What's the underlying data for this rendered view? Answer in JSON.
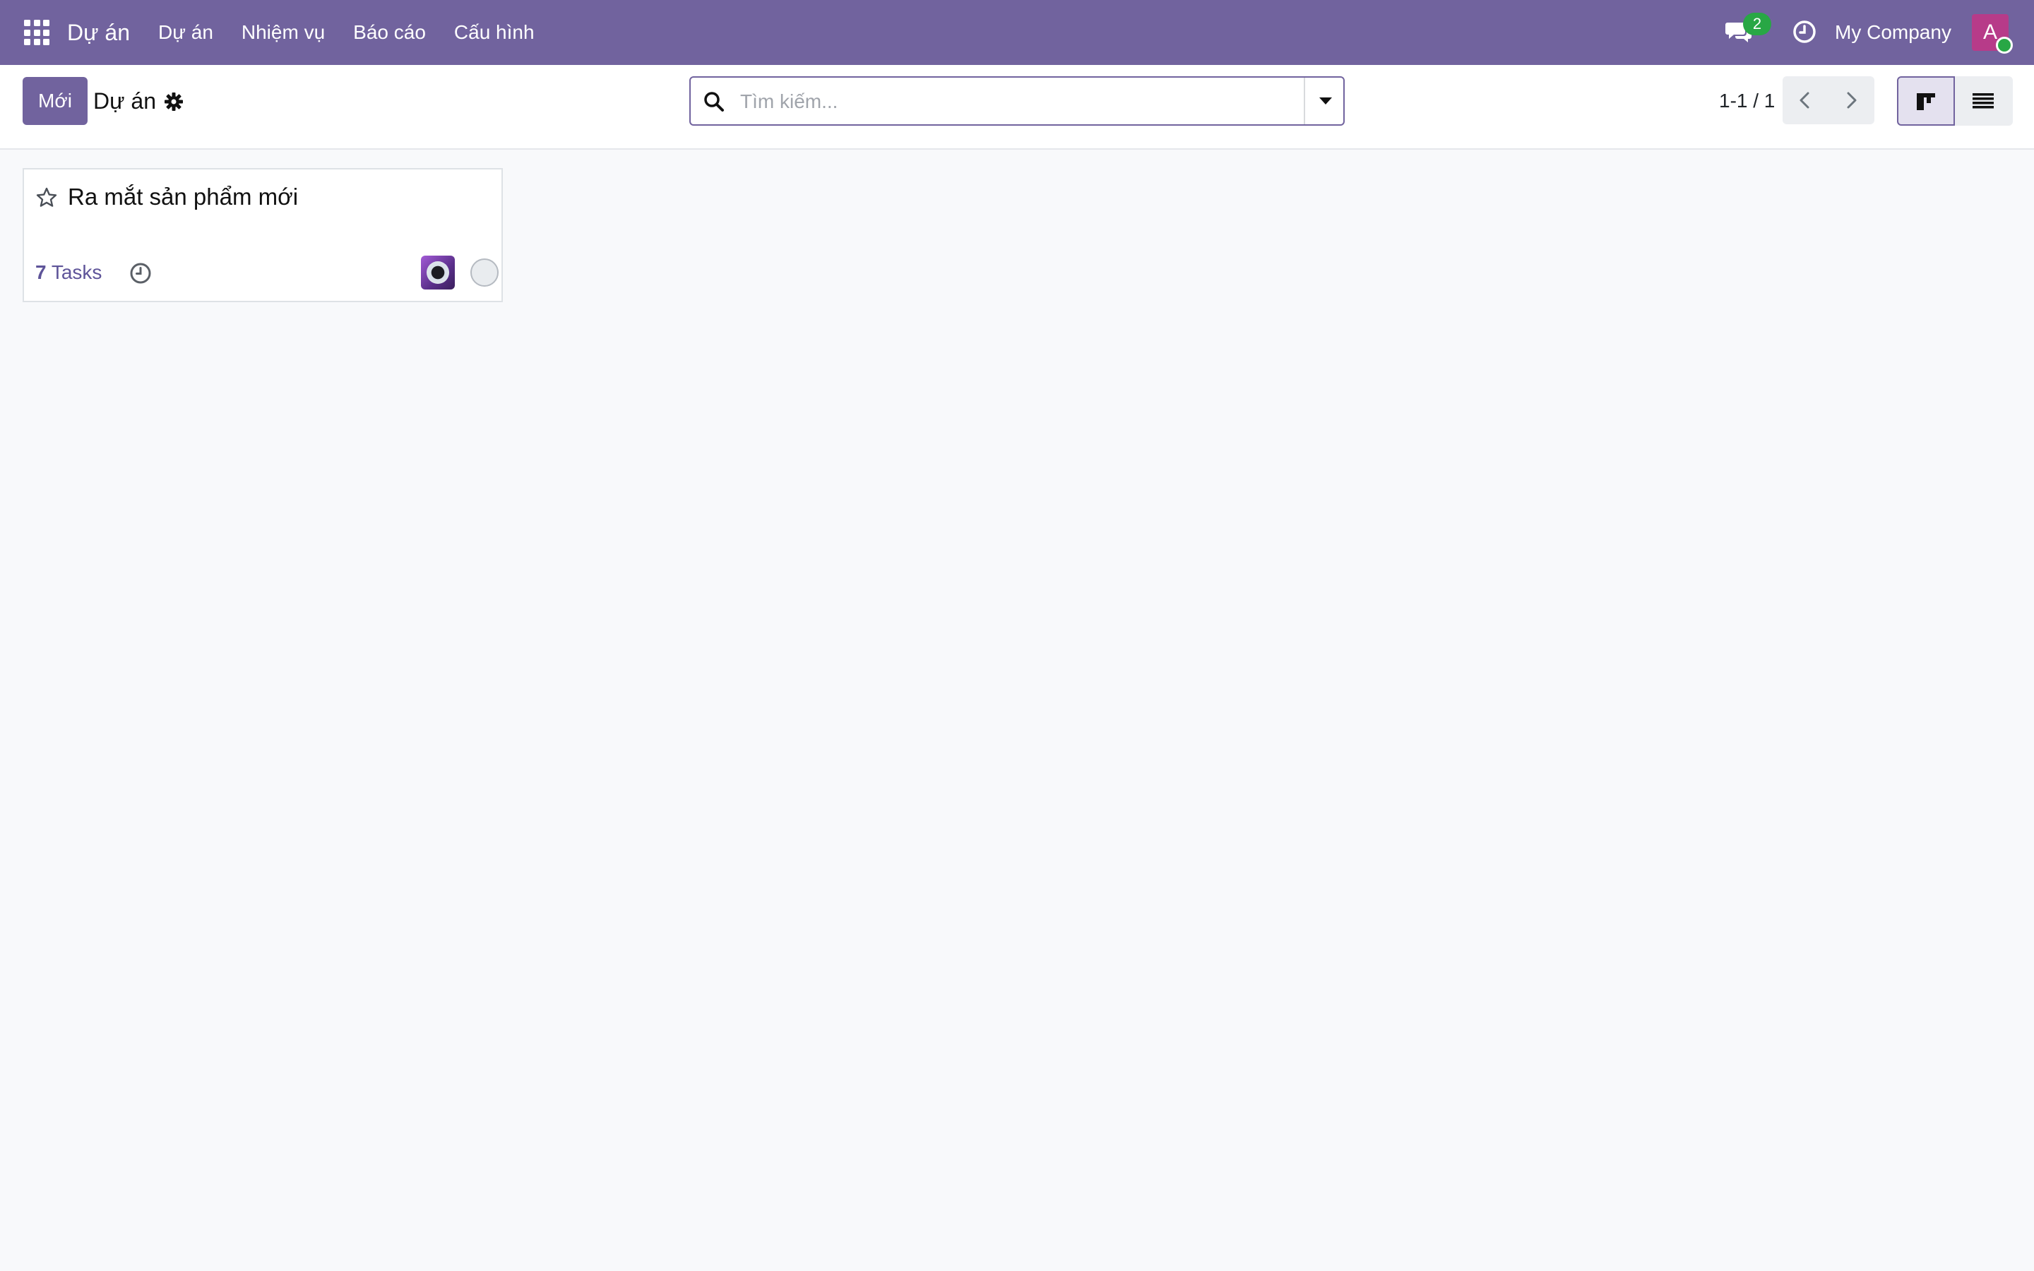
{
  "navbar": {
    "app_name": "Dự án",
    "menu": [
      {
        "label": "Dự án"
      },
      {
        "label": "Nhiệm vụ"
      },
      {
        "label": "Báo cáo"
      },
      {
        "label": "Cấu hình"
      }
    ],
    "messages_count": "2",
    "company": "My Company",
    "user_initial": "A"
  },
  "control": {
    "new_label": "Mới",
    "breadcrumb": "Dự án",
    "search_placeholder": "Tìm kiếm...",
    "pager": "1-1 / 1"
  },
  "kanban": {
    "cards": [
      {
        "title": "Ra mắt sản phẩm mới",
        "task_count": "7",
        "task_label": "Tasks"
      }
    ]
  },
  "colors": {
    "brand": "#71639e",
    "badge": "#28a745",
    "avatar": "#b73b89",
    "link": "#5e5499"
  }
}
